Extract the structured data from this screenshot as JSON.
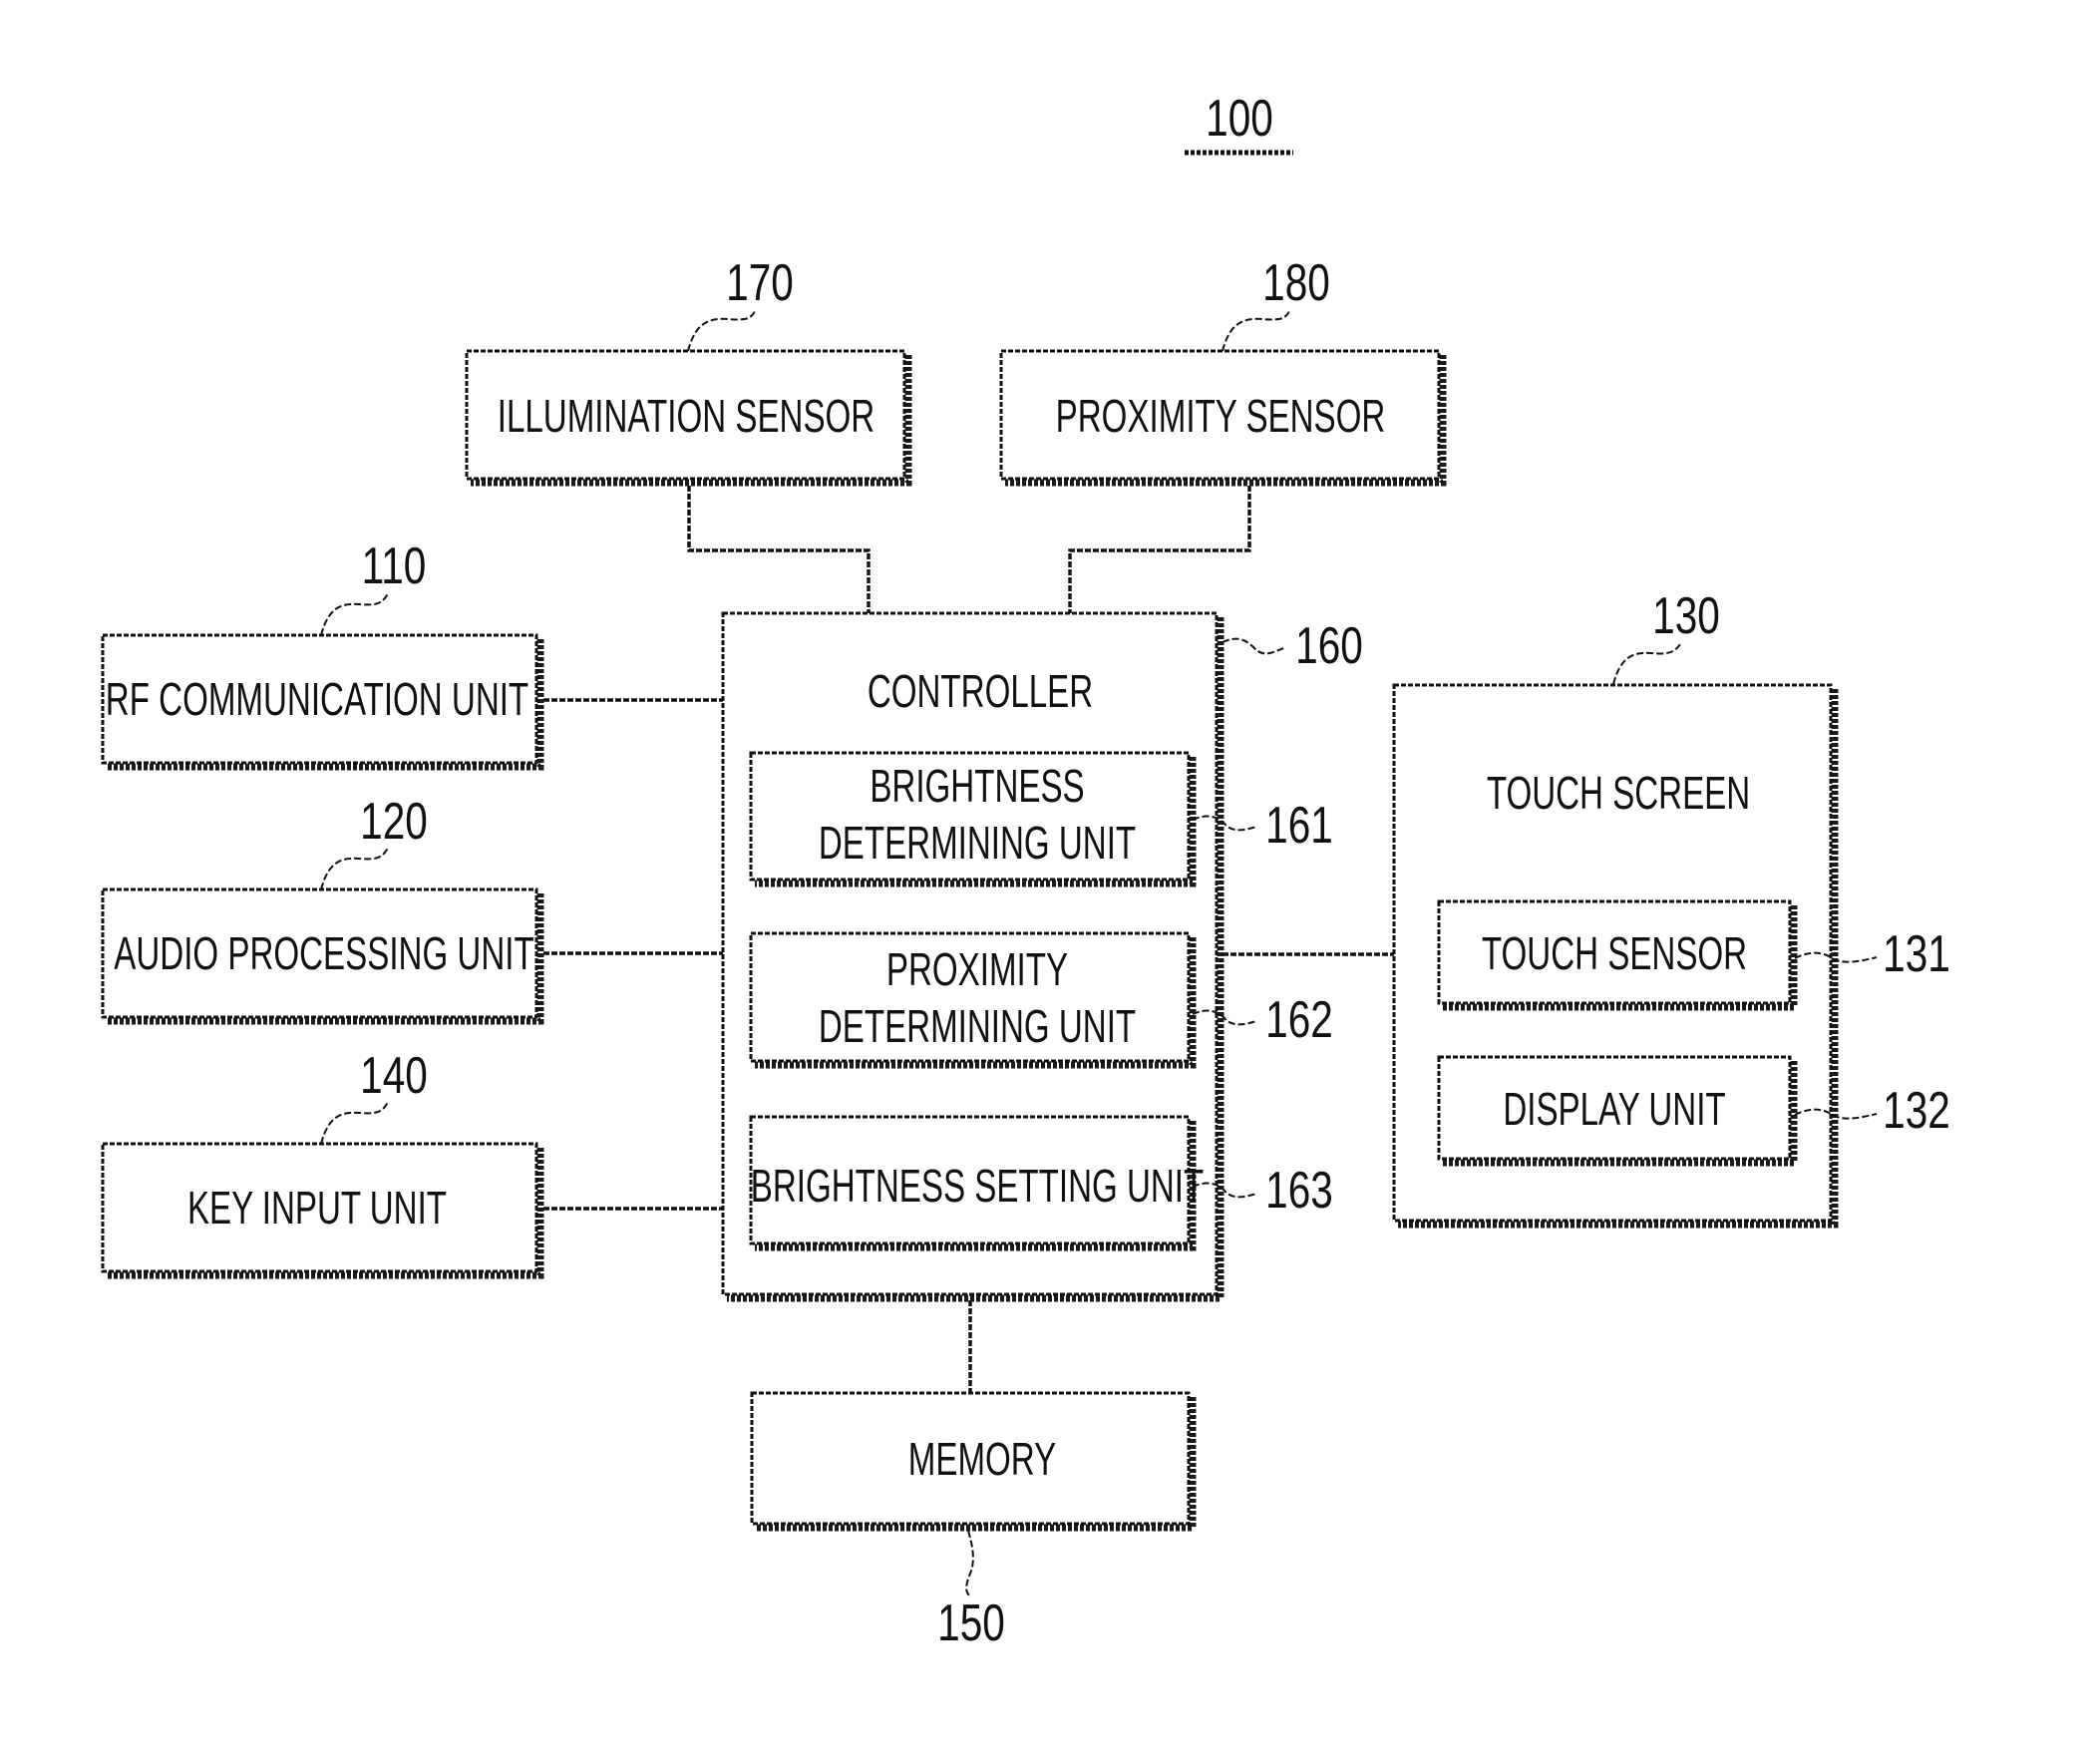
{
  "figure": {
    "reference": "100",
    "blocks": {
      "illumination_sensor": {
        "label": "ILLUMINATION SENSOR",
        "ref": "170"
      },
      "proximity_sensor": {
        "label": "PROXIMITY SENSOR",
        "ref": "180"
      },
      "rf_communication_unit": {
        "label": "RF COMMUNICATION UNIT",
        "ref": "110"
      },
      "audio_processing_unit": {
        "label": "AUDIO PROCESSING UNIT",
        "ref": "120"
      },
      "key_input_unit": {
        "label": "KEY INPUT UNIT",
        "ref": "140"
      },
      "controller": {
        "label": "CONTROLLER",
        "ref": "160",
        "sub": {
          "brightness_determining_unit": {
            "lines": [
              "BRIGHTNESS",
              "DETERMINING UNIT"
            ],
            "ref": "161"
          },
          "proximity_determining_unit": {
            "lines": [
              "PROXIMITY",
              "DETERMINING UNIT"
            ],
            "ref": "162"
          },
          "brightness_setting_unit": {
            "label": "BRIGHTNESS SETTING UNIT",
            "ref": "163"
          }
        }
      },
      "touch_screen": {
        "label": "TOUCH SCREEN",
        "ref": "130",
        "sub": {
          "touch_sensor": {
            "label": "TOUCH SENSOR",
            "ref": "131"
          },
          "display_unit": {
            "label": "DISPLAY UNIT",
            "ref": "132"
          }
        }
      },
      "memory": {
        "label": "MEMORY",
        "ref": "150"
      }
    }
  }
}
